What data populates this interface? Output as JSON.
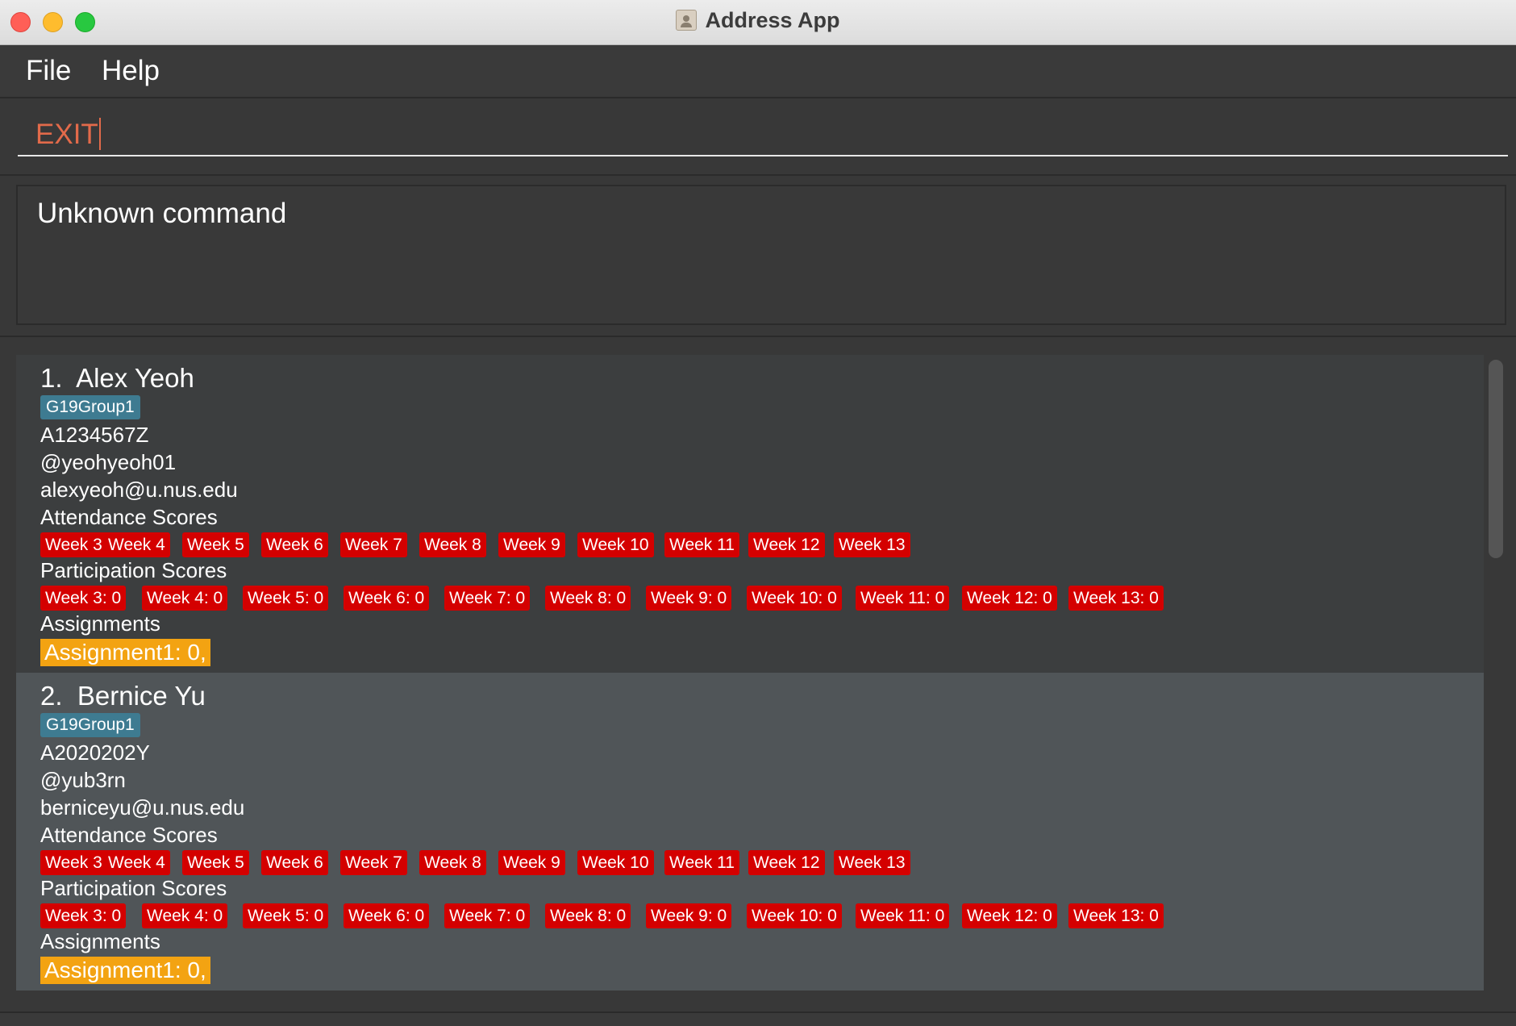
{
  "window": {
    "title": "Address App"
  },
  "menu": {
    "file": "File",
    "help": "Help"
  },
  "command": {
    "value": "EXIT"
  },
  "result": {
    "message": "Unknown command"
  },
  "labels": {
    "attendance": "Attendance Scores",
    "participation": "Participation Scores",
    "assignments": "Assignments"
  },
  "persons": [
    {
      "index": "1.",
      "name": "Alex Yeoh",
      "group": "G19Group1",
      "student_id": "A1234567Z",
      "telegram": "@yeohyeoh01",
      "email": "alexyeoh@u.nus.edu",
      "attendance": [
        "Week 3",
        "Week 4",
        "Week 5",
        "Week 6",
        "Week 7",
        "Week 8",
        "Week 9",
        "Week 10",
        "Week 11",
        "Week 12",
        "Week 13"
      ],
      "participation": [
        "Week 3: 0",
        "Week 4: 0",
        "Week 5: 0",
        "Week 6: 0",
        "Week 7: 0",
        "Week 8: 0",
        "Week 9: 0",
        "Week 10: 0",
        "Week 11: 0",
        "Week 12: 0",
        "Week 13: 0"
      ],
      "assignment": "Assignment1: 0,"
    },
    {
      "index": "2.",
      "name": "Bernice Yu",
      "group": "G19Group1",
      "student_id": "A2020202Y",
      "telegram": "@yub3rn",
      "email": "berniceyu@u.nus.edu",
      "attendance": [
        "Week 3",
        "Week 4",
        "Week 5",
        "Week 6",
        "Week 7",
        "Week 8",
        "Week 9",
        "Week 10",
        "Week 11",
        "Week 12",
        "Week 13"
      ],
      "participation": [
        "Week 3: 0",
        "Week 4: 0",
        "Week 5: 0",
        "Week 6: 0",
        "Week 7: 0",
        "Week 8: 0",
        "Week 9: 0",
        "Week 10: 0",
        "Week 11: 0",
        "Week 12: 0",
        "Week 13: 0"
      ],
      "assignment": "Assignment1: 0,"
    }
  ],
  "colors": {
    "attendance_tag": "#d40000",
    "group_tag": "#3e7b91",
    "assignment_tag": "#f3a312",
    "command_text": "#e26a4a"
  }
}
